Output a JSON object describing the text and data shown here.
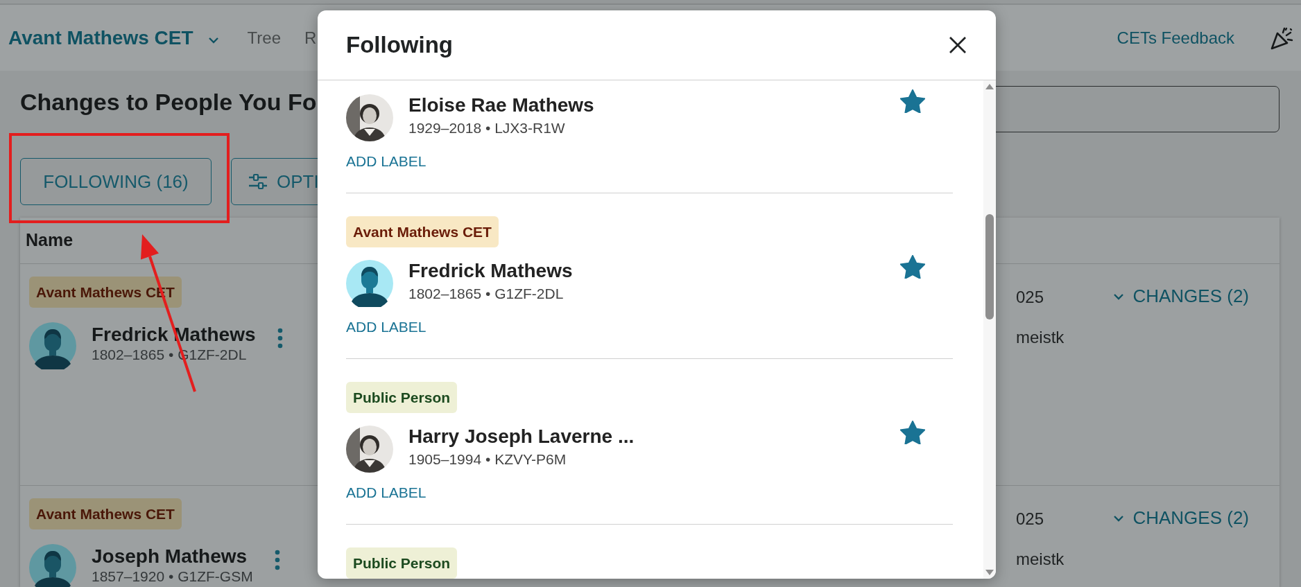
{
  "header": {
    "brand": "Avant Mathews CET",
    "nav": [
      {
        "label": "Tree"
      },
      {
        "label": "R"
      }
    ],
    "feedback": "CETs Feedback"
  },
  "page_title": "Changes to People You Fo",
  "toolbar": {
    "following": "FOLLOWING (16)",
    "options": "OPTI"
  },
  "table": {
    "columns": [
      "Name"
    ],
    "rows": [
      {
        "label": "Avant Mathews CET",
        "avatar": {
          "kind": "silhouette"
        },
        "name": "Fredrick Mathews",
        "dates": "1802–1865 • G1ZF-2DL",
        "date": "025",
        "user": "meistk",
        "changes": "CHANGES (2)"
      },
      {
        "label": "Avant Mathews CET",
        "avatar": {
          "kind": "silhouette"
        },
        "name": "Joseph Mathews",
        "dates": "1857–1920 • G1ZF-GSM",
        "date": "025",
        "user": "meistk",
        "changes": "CHANGES (2)"
      }
    ]
  },
  "modal": {
    "title": "Following",
    "people": [
      {
        "name": "Eloise Rae Mathews",
        "dates": "1929–2018 • LJX3-R1W",
        "starred": true,
        "action": "ADD LABEL"
      },
      {
        "label": {
          "text": "Avant Mathews CET",
          "kind": "tree"
        },
        "avatar": {
          "kind": "silhouette"
        },
        "name": "Fredrick Mathews",
        "dates": "1802–1865 • G1ZF-2DL",
        "starred": true,
        "action": "ADD LABEL"
      },
      {
        "label": {
          "text": "Public Person",
          "kind": "public"
        },
        "name": "Harry Joseph Laverne ...",
        "dates": "1905–1994 • KZVY-P6M",
        "starred": true,
        "action": "ADD LABEL"
      },
      {
        "label": {
          "text": "Public Person",
          "kind": "public"
        }
      }
    ]
  }
}
